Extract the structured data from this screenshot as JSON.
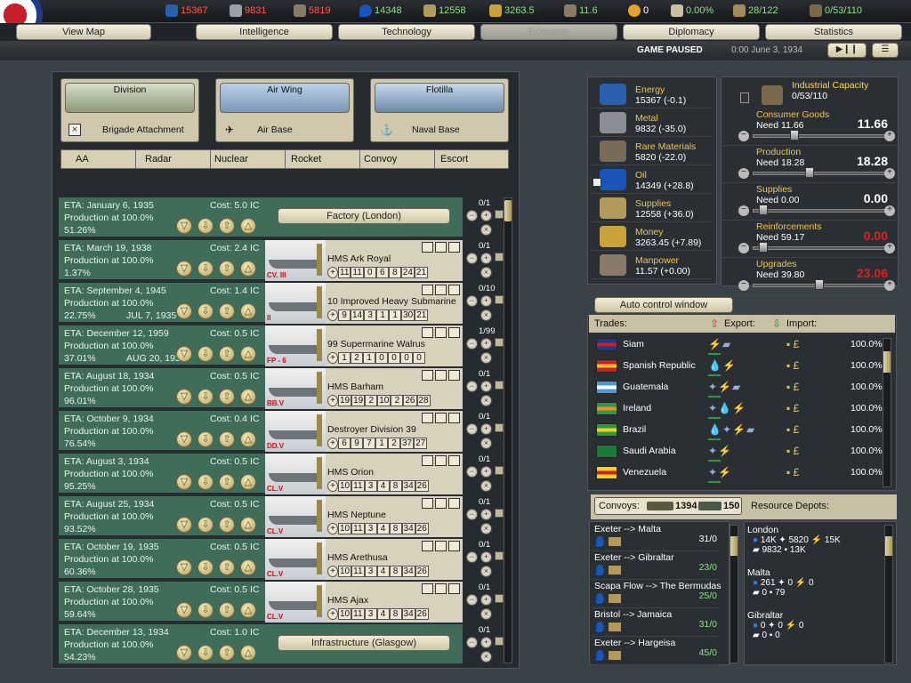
{
  "topbar": {
    "energy": "15367",
    "metal": "9831",
    "rare": "5819",
    "oil": "14348",
    "supplies": "12558",
    "money": "3263.5",
    "manpower": "11.6",
    "nuclear": "0",
    "dissent": "0.00%",
    "transports": "28/122",
    "ic": "0/53/110"
  },
  "tabs": [
    "View Map",
    "Intelligence",
    "Technology",
    "Economy",
    "Diplomacy",
    "Statistics"
  ],
  "status": {
    "paused": "GAME PAUSED",
    "date": "0:00 June 3, 1934"
  },
  "build": {
    "division": "Division",
    "airwing": "Air Wing",
    "flotilla": "Flotilla",
    "brigade": "Brigade Attachment",
    "airbase": "Air Base",
    "navalbase": "Naval Base",
    "special": [
      "AA",
      "Radar",
      "Nuclear",
      "Rocket",
      "Convoy",
      "Escort"
    ]
  },
  "queue": [
    {
      "eta": "ETA: January 6, 1935",
      "cost": "Cost: 5.0 IC",
      "prod": "Production at 100.0%",
      "pct": "51.26%",
      "date2": "",
      "count": "0/1",
      "kind": "button",
      "label": "Factory (London)"
    },
    {
      "eta": "ETA: March 19, 1938",
      "cost": "Cost: 2.4 IC",
      "prod": "Production at 100.0%",
      "pct": "1.37%",
      "date2": "",
      "count": "0/1",
      "kind": "unit",
      "name": "HMS Ark Royal",
      "cls": "CV. III",
      "stats": [
        "11",
        "11",
        "0",
        "6",
        "8",
        "24",
        "21"
      ]
    },
    {
      "eta": "ETA: September 4, 1945",
      "cost": "Cost: 1.4 IC",
      "prod": "Production at 100.0%",
      "pct": "22.75%",
      "date2": "JUL 7, 1935",
      "count": "0/10",
      "kind": "unit",
      "name": "10 Improved Heavy Submarine",
      "cls": "II",
      "stats": [
        "9",
        "14",
        "3",
        "1",
        "1",
        "30",
        "21"
      ]
    },
    {
      "eta": "ETA: December 12, 1959",
      "cost": "Cost: 0.5 IC",
      "prod": "Production at 100.0%",
      "pct": "37.01%",
      "date2": "AUG 20, 1934",
      "count": "1/99",
      "kind": "unit",
      "name": "99 Supermarine Walrus",
      "cls": "FP - 6",
      "stats": [
        "1",
        "2",
        "1",
        "0",
        "0",
        "0",
        "0"
      ]
    },
    {
      "eta": "ETA: August 18, 1934",
      "cost": "Cost: 0.5 IC",
      "prod": "Production at 100.0%",
      "pct": "96.01%",
      "date2": "",
      "count": "0/1",
      "kind": "unit",
      "name": "HMS Barham",
      "cls": "BB.V",
      "stats": [
        "19",
        "19",
        "2",
        "10",
        "2",
        "26",
        "28"
      ]
    },
    {
      "eta": "ETA: October 9, 1934",
      "cost": "Cost: 0.4 IC",
      "prod": "Production at 100.0%",
      "pct": "76.54%",
      "date2": "",
      "count": "0/1",
      "kind": "unit",
      "name": "Destroyer Division 39",
      "cls": "DD.V",
      "stats": [
        "6",
        "9",
        "7",
        "1",
        "2",
        "37",
        "27"
      ]
    },
    {
      "eta": "ETA: August 3, 1934",
      "cost": "Cost: 0.5 IC",
      "prod": "Production at 100.0%",
      "pct": "95.25%",
      "date2": "",
      "count": "0/1",
      "kind": "unit",
      "name": "HMS Orion",
      "cls": "CL.V",
      "stats": [
        "10",
        "11",
        "3",
        "4",
        "8",
        "34",
        "26"
      ]
    },
    {
      "eta": "ETA: August 25, 1934",
      "cost": "Cost: 0.5 IC",
      "prod": "Production at 100.0%",
      "pct": "93.52%",
      "date2": "",
      "count": "0/1",
      "kind": "unit",
      "name": "HMS Neptune",
      "cls": "CL.V",
      "stats": [
        "10",
        "11",
        "3",
        "4",
        "8",
        "34",
        "26"
      ]
    },
    {
      "eta": "ETA: October 19, 1935",
      "cost": "Cost: 0.5 IC",
      "prod": "Production at 100.0%",
      "pct": "60.36%",
      "date2": "",
      "count": "0/1",
      "kind": "unit",
      "name": "HMS Arethusa",
      "cls": "CL.V",
      "stats": [
        "10",
        "11",
        "3",
        "4",
        "8",
        "34",
        "26"
      ]
    },
    {
      "eta": "ETA: October 28, 1935",
      "cost": "Cost: 0.5 IC",
      "prod": "Production at 100.0%",
      "pct": "59.64%",
      "date2": "",
      "count": "0/1",
      "kind": "unit",
      "name": "HMS Ajax",
      "cls": "CL.V",
      "stats": [
        "10",
        "11",
        "3",
        "4",
        "8",
        "34",
        "26"
      ]
    },
    {
      "eta": "ETA: December 13, 1934",
      "cost": "Cost: 1.0 IC",
      "prod": "Production at 100.0%",
      "pct": "54.23%",
      "date2": "",
      "count": "0/1",
      "kind": "button",
      "label": "Infrastructure (Glasgow)"
    }
  ],
  "resources": [
    {
      "name": "Energy",
      "val": "15367 (-0.1)",
      "color": "#2a5fb0"
    },
    {
      "name": "Metal",
      "val": "9832 (-35.0)",
      "color": "#8a8f96"
    },
    {
      "name": "Rare Materials",
      "val": "5820 (-22.0)",
      "color": "#7a6a5a"
    },
    {
      "name": "Oil",
      "val": "14349 (+28.8)",
      "color": "#1c55b8"
    },
    {
      "name": "Supplies",
      "val": "12558 (+36.0)",
      "color": "#b49a5a"
    },
    {
      "name": "Money",
      "val": "3263.45 (+7.89)",
      "color": "#c9a33a"
    },
    {
      "name": "Manpower",
      "val": "11.57 (+0.00)",
      "color": "#8a7a6a"
    }
  ],
  "ic": {
    "title": "Industrial Capacity",
    "value": "0/53/110",
    "rows": [
      {
        "name": "Consumer Goods",
        "need": "Need 11.66",
        "big": "11.66",
        "color": "#ffffff",
        "pos": 0.3,
        "level": "11.66"
      },
      {
        "name": "Production",
        "need": "Need 18.28",
        "big": "18.28",
        "color": "#ffffff",
        "pos": 0.42,
        "level": "18.28"
      },
      {
        "name": "Supplies",
        "need": "Need 0.00",
        "big": "0.00",
        "color": "#ffffff",
        "pos": 0.05,
        "level": "0.00"
      },
      {
        "name": "Reinforcements",
        "need": "Need 59.17",
        "big": "0.00",
        "color": "#e02020",
        "pos": 0.05,
        "level": "0.00"
      },
      {
        "name": "Upgrades",
        "need": "Need 39.80",
        "big": "23.06",
        "color": "#e02020",
        "pos": 0.5,
        "level": "23.06"
      }
    ]
  },
  "auto": "Auto control window",
  "trades": {
    "header": "Trades:",
    "export": "Export:",
    "import": "Import:",
    "rows": [
      {
        "country": "Siam",
        "pct": "100.0%",
        "c1": "#1a3a8a",
        "c2": "#c8202a",
        "ex": "⚡▰",
        "im": "▪ £"
      },
      {
        "country": "Spanish Republic",
        "pct": "100.0%",
        "c1": "#c8202a",
        "c2": "#f0c020",
        "ex": "💧⚡",
        "im": "▪ £"
      },
      {
        "country": "Guatemala",
        "pct": "100.0%",
        "c1": "#4a9ad8",
        "c2": "#ffffff",
        "ex": "✦⚡▰",
        "im": "▪ £"
      },
      {
        "country": "Ireland",
        "pct": "100.0%",
        "c1": "#2a9a4a",
        "c2": "#f08a2a",
        "ex": "✦💧⚡",
        "im": "▪ £"
      },
      {
        "country": "Brazil",
        "pct": "100.0%",
        "c1": "#2a9a3a",
        "c2": "#f0d020",
        "ex": "💧✦⚡▰",
        "im": "▪ £"
      },
      {
        "country": "Saudi Arabia",
        "pct": "100.0%",
        "c1": "#1a7a3a",
        "c2": "#1a7a3a",
        "ex": "✦⚡",
        "im": "▪ £"
      },
      {
        "country": "Venezuela",
        "pct": "100.0%",
        "c1": "#f0d020",
        "c2": "#c8202a",
        "ex": "✦⚡",
        "im": "▪ £"
      }
    ]
  },
  "convoys": {
    "label": "Convoys:",
    "transports": "1394",
    "escorts": "150",
    "depots": "Resource Depots:"
  },
  "routes": [
    {
      "route": "Exeter --> Malta",
      "n": "31/0",
      "color": "#ffffff"
    },
    {
      "route": "Exeter --> Gibraltar",
      "n": "23/0",
      "color": "#8fe08f"
    },
    {
      "route": "Scapa Flow --> The Bermudas",
      "n": "25/0",
      "color": "#8fe08f"
    },
    {
      "route": "Bristol --> Jamaica",
      "n": "31/0",
      "color": "#8fe08f"
    },
    {
      "route": "Exeter --> Hargeisa",
      "n": "45/0",
      "color": "#8fe08f"
    }
  ],
  "depots": [
    {
      "name": "London",
      "a": "14K",
      "b": "5820",
      "c": "15K",
      "d": "9832",
      "e": "13K"
    },
    {
      "name": "Malta",
      "a": "261",
      "b": "0",
      "c": "0",
      "d": "0",
      "e": "79"
    },
    {
      "name": "Gibraltar",
      "a": "0",
      "b": "0",
      "c": "0",
      "d": "0",
      "e": "0"
    }
  ]
}
